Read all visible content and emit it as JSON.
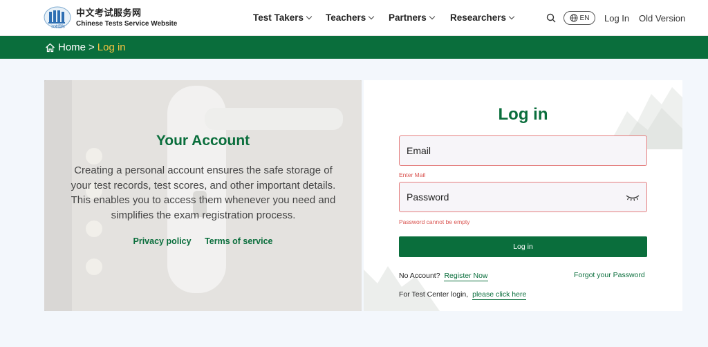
{
  "header": {
    "logo_cn": "中文考试服务网",
    "logo_en": "Chinese Tests Service Website",
    "logo_badge": "汉考国际",
    "nav": [
      {
        "label": "Test Takers"
      },
      {
        "label": "Teachers"
      },
      {
        "label": "Partners"
      },
      {
        "label": "Researchers"
      }
    ],
    "lang": "EN",
    "login_link": "Log In",
    "old_version": "Old Version"
  },
  "breadcrumb": {
    "home": "Home",
    "separator": ">",
    "current": "Log in"
  },
  "account": {
    "title": "Your Account",
    "description": "Creating a personal account ensures the safe storage of your test records, test scores, and other important details. This enables you to access them whenever you need and simplifies the exam registration process.",
    "privacy": "Privacy policy",
    "terms": "Terms of service"
  },
  "login": {
    "title": "Log in",
    "email_placeholder": "Email",
    "email_error": "Enter Mail",
    "password_placeholder": "Password",
    "password_error": "Password cannot be empty",
    "button": "Log in",
    "no_account": "No Account?",
    "register": "Register Now",
    "forgot": "Forgot your Password",
    "test_center": "For Test Center login,",
    "click_here": "please click here"
  },
  "colors": {
    "brand_green": "#0a6e3c",
    "breadcrumb_current": "#f3c240",
    "error_red": "#d9534f"
  }
}
